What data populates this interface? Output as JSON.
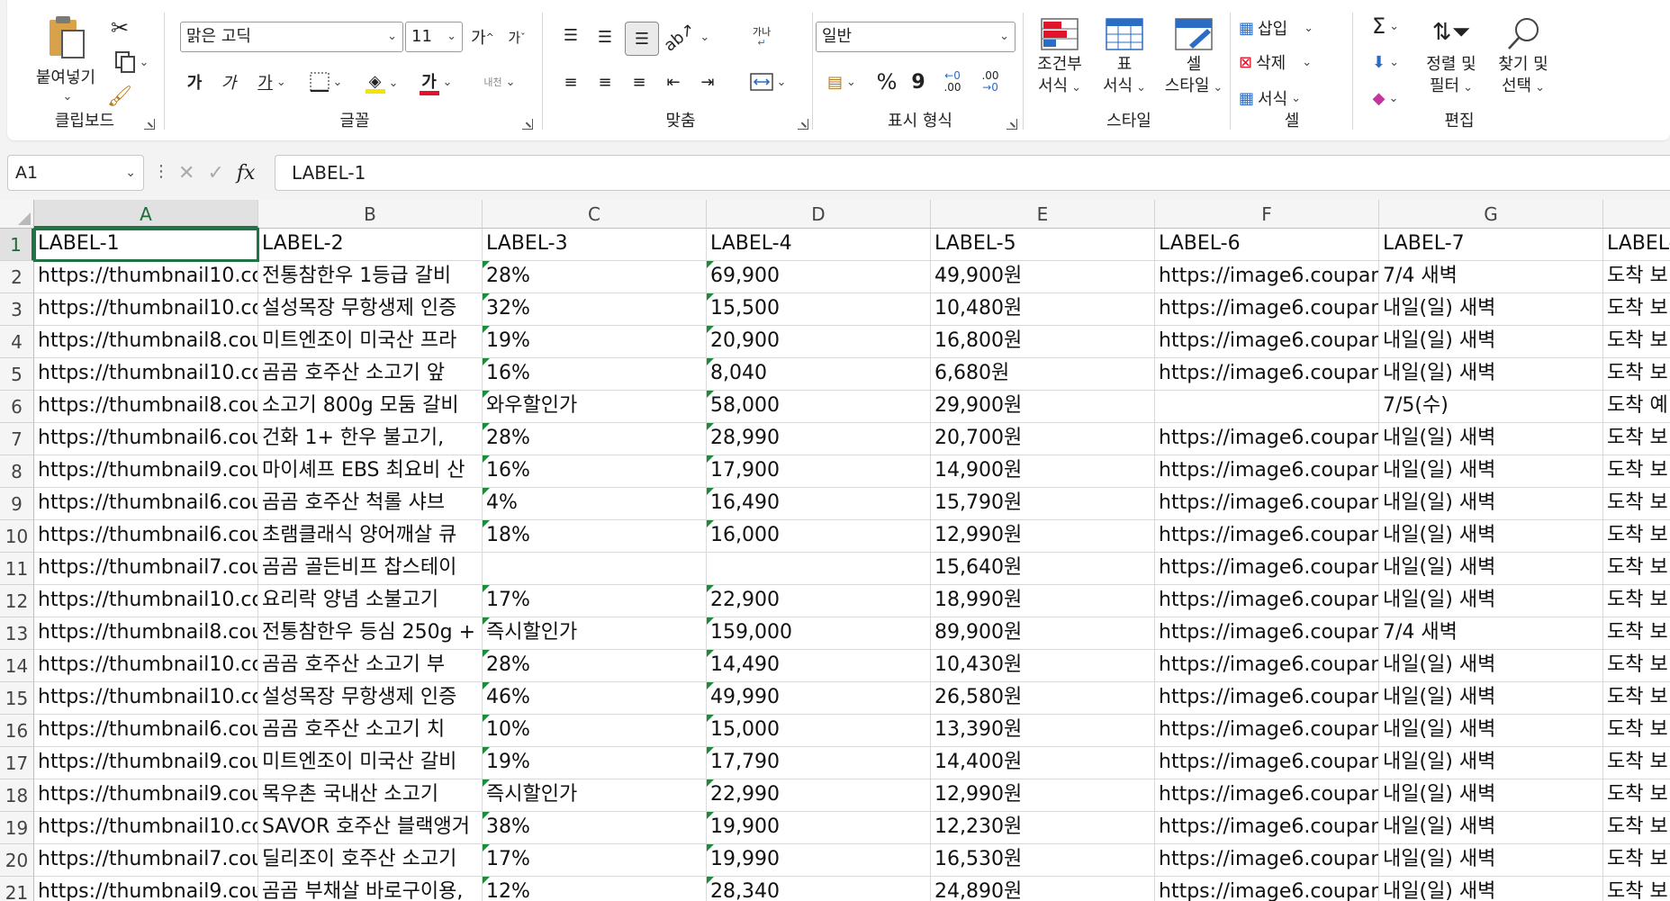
{
  "ribbon": {
    "clipboard": {
      "title": "클립보드",
      "paste_label": "붙여넣기"
    },
    "font": {
      "title": "글꼴",
      "font_name": "맑은 고딕",
      "font_size": "11",
      "increase_label": "가",
      "decrease_label": "가",
      "bold_label": "가",
      "italic_label": "가",
      "underline_label": "가",
      "font_color_label": "가",
      "phonetic_label": "내천"
    },
    "alignment": {
      "title": "맞춤",
      "wrap_label": "가나"
    },
    "number": {
      "title": "표시 형식",
      "format": "일반",
      "percent_label": "%",
      "comma_label": "9",
      "inc_decimal_label": ".00",
      "dec_decimal_label": ".00"
    },
    "styles": {
      "title": "스타일",
      "conditional_line1": "조건부",
      "conditional_line2": "서식",
      "table_line1": "표",
      "table_line2": "서식",
      "cell_line1": "셀",
      "cell_line2": "스타일"
    },
    "cells": {
      "title": "셀",
      "insert_label": "삽입",
      "delete_label": "삭제",
      "format_label": "서식"
    },
    "editing": {
      "title": "편집",
      "sort_line1": "정렬 및",
      "sort_line2": "필터",
      "find_line1": "찾기 및",
      "find_line2": "선택"
    }
  },
  "formula_bar": {
    "name_box": "A1",
    "fx_label": "fx",
    "content": "LABEL-1"
  },
  "columns": [
    "A",
    "B",
    "C",
    "D",
    "E",
    "F",
    "G"
  ],
  "rows": [
    [
      "LABEL-1",
      "LABEL-2",
      "LABEL-3",
      "LABEL-4",
      "LABEL-5",
      "LABEL-6",
      "LABEL-7",
      "LABEL-"
    ],
    [
      "https://thumbnail10.cou",
      "전통참한우 1등급 갈비",
      "28%",
      "69,900",
      "49,900원",
      "https://image6.coupang",
      "7/4 새벽",
      "도착 보"
    ],
    [
      "https://thumbnail10.cou",
      "설성목장 무항생제 인증",
      "32%",
      "15,500",
      "10,480원",
      "https://image6.coupang",
      "내일(일) 새벽",
      "도착 보"
    ],
    [
      "https://thumbnail8.coup",
      "미트엔조이 미국산 프라",
      "19%",
      "20,900",
      "16,800원",
      "https://image6.coupang",
      "내일(일) 새벽",
      "도착 보"
    ],
    [
      "https://thumbnail10.cou",
      "곰곰 호주산 소고기 앞",
      "16%",
      "8,040",
      "6,680원",
      "https://image6.coupang",
      "내일(일) 새벽",
      "도착 보"
    ],
    [
      "https://thumbnail8.coup",
      "소고기 800g 모둠 갈비",
      "와우할인가",
      "58,000",
      "29,900원",
      "",
      "7/5(수)",
      "도착 예"
    ],
    [
      "https://thumbnail6.coup",
      "건화 1+ 한우 불고기,",
      "28%",
      "28,990",
      "20,700원",
      "https://image6.coupang",
      "내일(일) 새벽",
      "도착 보"
    ],
    [
      "https://thumbnail9.coup",
      "마이셰프 EBS 최요비 산",
      "16%",
      "17,900",
      "14,900원",
      "https://image6.coupang",
      "내일(일) 새벽",
      "도착 보"
    ],
    [
      "https://thumbnail6.coup",
      "곰곰 호주산 척롤 샤브",
      "4%",
      "16,490",
      "15,790원",
      "https://image6.coupang",
      "내일(일) 새벽",
      "도착 보"
    ],
    [
      "https://thumbnail6.coup",
      "초램클래식 양어깨살 큐",
      "18%",
      "16,000",
      "12,990원",
      "https://image6.coupang",
      "내일(일) 새벽",
      "도착 보"
    ],
    [
      "https://thumbnail7.coup",
      "곰곰 골든비프 찹스테이",
      "",
      "",
      "15,640원",
      "https://image6.coupang",
      "내일(일) 새벽",
      "도착 보"
    ],
    [
      "https://thumbnail10.cou",
      "요리락 양념 소불고기",
      "17%",
      "22,900",
      "18,990원",
      "https://image6.coupang",
      "내일(일) 새벽",
      "도착 보"
    ],
    [
      "https://thumbnail8.coup",
      "전통참한우 등심 250g +",
      "즉시할인가",
      "159,000",
      "89,900원",
      "https://image6.coupang",
      "7/4 새벽",
      "도착 보"
    ],
    [
      "https://thumbnail10.cou",
      "곰곰 호주산 소고기 부",
      "28%",
      "14,490",
      "10,430원",
      "https://image6.coupang",
      "내일(일) 새벽",
      "도착 보"
    ],
    [
      "https://thumbnail10.cou",
      "설성목장 무항생제 인증",
      "46%",
      "49,990",
      "26,580원",
      "https://image6.coupang",
      "내일(일) 새벽",
      "도착 보"
    ],
    [
      "https://thumbnail6.coup",
      "곰곰 호주산 소고기 치",
      "10%",
      "15,000",
      "13,390원",
      "https://image6.coupang",
      "내일(일) 새벽",
      "도착 보"
    ],
    [
      "https://thumbnail9.coup",
      "미트엔조이 미국산 갈비",
      "19%",
      "17,790",
      "14,400원",
      "https://image6.coupang",
      "내일(일) 새벽",
      "도착 보"
    ],
    [
      "https://thumbnail9.coup",
      "목우촌 국내산 소고기",
      "즉시할인가",
      "22,990",
      "12,990원",
      "https://image6.coupang",
      "내일(일) 새벽",
      "도착 보"
    ],
    [
      "https://thumbnail10.cou",
      "SAVOR 호주산 블랙앵거",
      "38%",
      "19,900",
      "12,230원",
      "https://image6.coupang",
      "내일(일) 새벽",
      "도착 보"
    ],
    [
      "https://thumbnail7.coup",
      "딜리조이 호주산 소고기",
      "17%",
      "19,990",
      "16,530원",
      "https://image6.coupang",
      "내일(일) 새벽",
      "도착 보"
    ],
    [
      "https://thumbnail9.coup",
      "곰곰 부채살 바로구이용,",
      "12%",
      "28,340",
      "24,890원",
      "https://image6.coupang",
      "내일(일) 새벽",
      "도착 보"
    ]
  ],
  "colors": {
    "accent": "#217346",
    "red": "#e0142b",
    "yellow": "#f2e600",
    "blue": "#2b6cc4"
  }
}
